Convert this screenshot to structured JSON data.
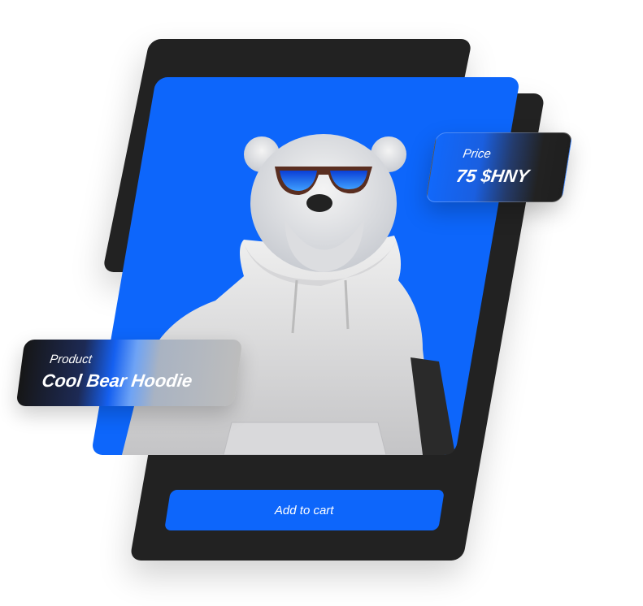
{
  "product": {
    "label": "Product",
    "name": "Cool Bear Hoodie"
  },
  "price": {
    "label": "Price",
    "value": "75 $HNY"
  },
  "cart": {
    "button_label": "Add to cart"
  },
  "colors": {
    "accent": "#0d66fb",
    "card": "#222222"
  }
}
